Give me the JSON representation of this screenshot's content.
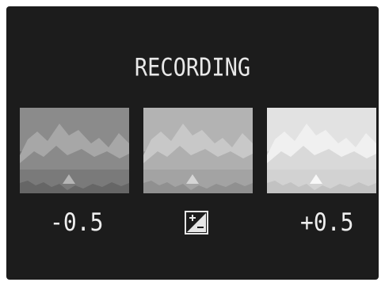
{
  "screen": {
    "title": "RECORDING",
    "bracket": [
      {
        "label": "-0.5",
        "brightness": "dark"
      },
      {
        "label": "",
        "brightness": "normal",
        "icon": "exposure-compensation-icon"
      },
      {
        "label": "+0.5",
        "brightness": "bright"
      }
    ]
  }
}
